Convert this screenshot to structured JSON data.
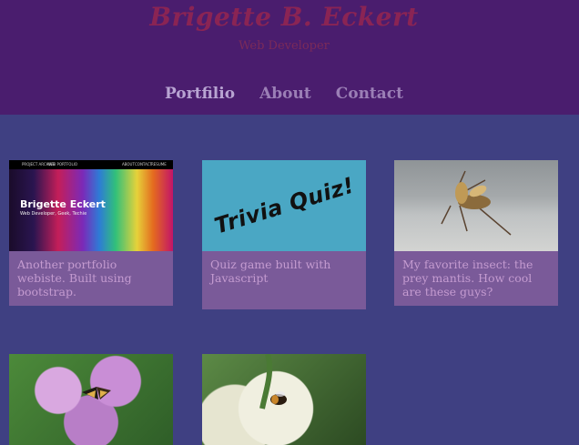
{
  "header": {
    "title": "Brigette B. Eckert",
    "subtitle": "Web Developer"
  },
  "nav": {
    "items": [
      {
        "label": "Portfilio",
        "active": true
      },
      {
        "label": "About",
        "active": false
      },
      {
        "label": "Contact",
        "active": false
      }
    ]
  },
  "cards": [
    {
      "thumbnail": "portfolio-screenshot",
      "thumb_title": "Brigette Eckert",
      "thumb_subtitle": "Web Developer, Geek, Techie",
      "thumb_nav_left_1": "PROJECT ARCHIVE",
      "thumb_nav_left_2": "WEB PORTFOLIO",
      "thumb_nav_right_1": "ABOUT",
      "thumb_nav_right_2": "CONTACT",
      "thumb_nav_right_3": "RESUME",
      "description": "Another portfolio webiste. Built using bootstrap."
    },
    {
      "thumbnail": "trivia-quiz-image",
      "thumb_text": "Trivia Quiz!",
      "description": "Quiz game built with Javascript"
    },
    {
      "thumbnail": "praying-mantis-photo",
      "description": "My favorite insect: the prey mantis. How cool are these guys?"
    },
    {
      "thumbnail": "lilac-butterfly-photo",
      "description": ""
    },
    {
      "thumbnail": "elderflower-bee-photo",
      "description": ""
    }
  ],
  "colors": {
    "header_bg": "#4a1d6e",
    "page_bg": "#3f4082",
    "card_bg": "#7a5a99",
    "title_color": "#8a2454",
    "nav_color": "#9b7fb6"
  }
}
